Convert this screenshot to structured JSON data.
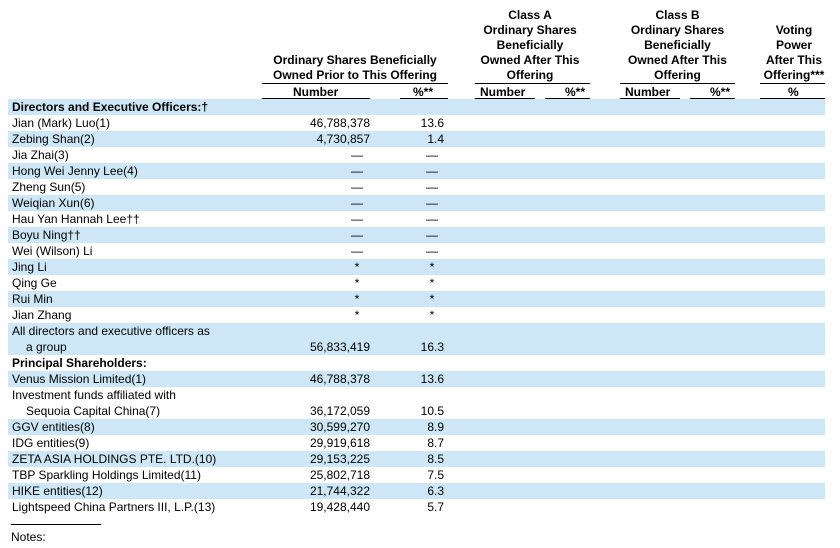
{
  "headers": {
    "prior": [
      "Ordinary Shares Beneficially",
      "Owned Prior to This Offering"
    ],
    "class_a": [
      "Class A",
      "Ordinary Shares",
      "Beneficially",
      "Owned After This",
      "Offering"
    ],
    "class_b": [
      "Class B",
      "Ordinary Shares",
      "Beneficially",
      "Owned After This",
      "Offering"
    ],
    "voting": [
      "Voting",
      "Power",
      "After This",
      "Offering***"
    ],
    "sub": {
      "prior_number": "Number",
      "prior_pct": "%**",
      "a_number": "Number",
      "a_pct": "%**",
      "b_number": "Number",
      "b_pct": "%**",
      "voting_pct": "%"
    }
  },
  "rows": [
    {
      "name": "Directors and Executive Officers:†",
      "number": "",
      "pct": "",
      "section": true
    },
    {
      "name": "Jian (Mark) Luo(1)",
      "number": "46,788,378",
      "pct": "13.6"
    },
    {
      "name": "Zebing Shan(2)",
      "number": "4,730,857",
      "pct": "1.4"
    },
    {
      "name": "Jia Zhai(3)",
      "number": "—",
      "pct": "—"
    },
    {
      "name": "Hong Wei Jenny Lee(4)",
      "number": "—",
      "pct": "—"
    },
    {
      "name": "Zheng Sun(5)",
      "number": "—",
      "pct": "—"
    },
    {
      "name": "Weiqian Xun(6)",
      "number": "—",
      "pct": "—"
    },
    {
      "name": "Hau Yan Hannah Lee††",
      "number": "—",
      "pct": "—"
    },
    {
      "name": "Boyu Ning††",
      "number": "—",
      "pct": "—"
    },
    {
      "name": "Wei (Wilson) Li",
      "number": "—",
      "pct": "—"
    },
    {
      "name": "Jing Li",
      "number": "*",
      "pct": "*"
    },
    {
      "name": "Qing Ge",
      "number": "*",
      "pct": "*"
    },
    {
      "name": "Rui Min",
      "number": "*",
      "pct": "*"
    },
    {
      "name": "Jian Zhang",
      "number": "*",
      "pct": "*"
    },
    {
      "name": "All directors and executive officers as",
      "name2": "a group",
      "number": "56,833,419",
      "pct": "16.3"
    },
    {
      "name": "Principal Shareholders:",
      "number": "",
      "pct": "",
      "section": true
    },
    {
      "name": "Venus Mission Limited(1)",
      "number": "46,788,378",
      "pct": "13.6"
    },
    {
      "name": "Investment funds affiliated with",
      "name2": "Sequoia Capital China(7)",
      "number": "36,172,059",
      "pct": "10.5"
    },
    {
      "name": "GGV entities(8)",
      "number": "30,599,270",
      "pct": "8.9"
    },
    {
      "name": "IDG entities(9)",
      "number": "29,919,618",
      "pct": "8.7"
    },
    {
      "name": "ZETA ASIA HOLDINGS PTE. LTD.(10)",
      "number": "29,153,225",
      "pct": "8.5"
    },
    {
      "name": "TBP Sparkling Holdings Limited(11)",
      "number": "25,802,718",
      "pct": "7.5"
    },
    {
      "name": "HIKE entities(12)",
      "number": "21,744,322",
      "pct": "6.3"
    },
    {
      "name": "Lightspeed China Partners III, L.P.(13)",
      "number": "19,428,440",
      "pct": "5.7"
    }
  ],
  "notes_label": "Notes:"
}
